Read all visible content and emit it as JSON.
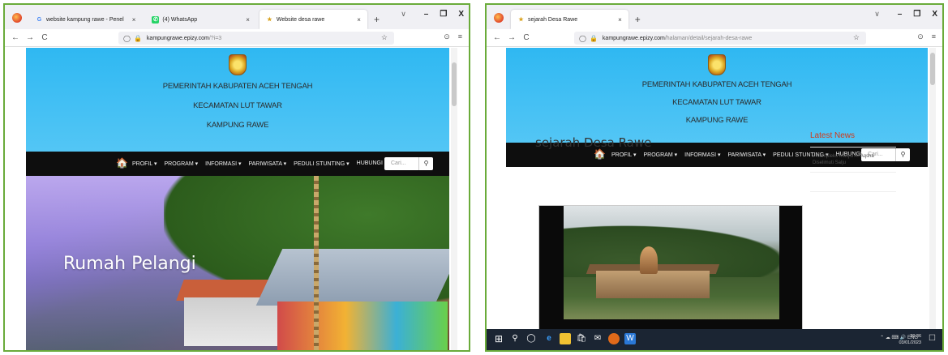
{
  "left": {
    "tabs": [
      {
        "label": "website kampung rawe - Penel",
        "favicon": "G",
        "favicon_color": "#4285f4"
      },
      {
        "label": "(4) WhatsApp",
        "favicon": "✆",
        "favicon_color": "#25d366"
      },
      {
        "label": "Website desa rawe",
        "favicon": "★",
        "favicon_color": "#d9a21e"
      }
    ],
    "url": {
      "host": "kampungrawe.epizy.com",
      "path": "/?i=3"
    },
    "header": {
      "line1": "PEMERINTAH KABUPATEN ACEH TENGAH",
      "line2": "KECAMATAN LUT TAWAR",
      "line3": "KAMPUNG RAWE"
    },
    "menu": [
      "PROFIL ▾",
      "PROGRAM ▾",
      "INFORMASI ▾",
      "PARIWISATA ▾",
      "PEDULI STUNTING ▾",
      "HUBUNGI KAMI"
    ],
    "search_placeholder": "Cari...",
    "hero_title": "Rumah Pelangi"
  },
  "right": {
    "tabs": [
      {
        "label": "sejarah Desa Rawe",
        "favicon": "★",
        "favicon_color": "#d9a21e"
      }
    ],
    "url": {
      "host": "kampungrawe.epizy.com",
      "path": "/halaman/detail/sejarah-desa-rawe"
    },
    "header": {
      "line1": "PEMERINTAH KABUPATEN ACEH TENGAH",
      "line2": "KECAMATAN LUT TAWAR",
      "line3": "KAMPUNG RAWE"
    },
    "menu": [
      "PROFIL ▾",
      "PROGRAM ▾",
      "INFORMASI ▾",
      "PARIWISATA ▾",
      "PEDULI STUNTING ▾",
      "HUBUNGI KAMI"
    ],
    "search_placeholder": "Cari...",
    "page_title": "sejarah Desa Rawe",
    "latest_news_title": "Latest News",
    "news": [
      "▸ Kompleks Masjid Al-Aqsha Diselimuti Salju"
    ],
    "taskbar": {
      "tray": "⌃ ☁ ⌨ 🔊 ENG",
      "time": "20:36",
      "date": "03/01/2023"
    }
  },
  "chrome": {
    "back": "←",
    "forward": "→",
    "reload": "C",
    "caret": "∨",
    "minimize": "–",
    "maximize": "❐",
    "close": "X",
    "newtab": "+",
    "tab_close": "×",
    "star": "☆",
    "shield": "◯",
    "lock": "🔒",
    "menu_btn": "≡",
    "pocket": "⊙"
  }
}
